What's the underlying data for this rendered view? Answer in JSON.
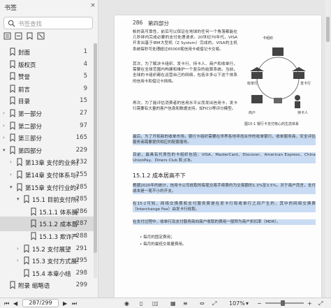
{
  "sidebar": {
    "title": "书签",
    "close_glyph": "×",
    "search_placeholder": "书签查找",
    "items": [
      {
        "label": "封面",
        "page": "1"
      },
      {
        "label": "版权页",
        "page": "4"
      },
      {
        "label": "赞誉",
        "page": "5"
      },
      {
        "label": "前言",
        "page": "9"
      },
      {
        "label": "目录",
        "page": "15"
      },
      {
        "label": "第一部分",
        "page": "27"
      },
      {
        "label": "第二部分",
        "page": "97"
      },
      {
        "label": "第三部分",
        "page": "165"
      },
      {
        "label": "第四部分",
        "page": "229"
      },
      {
        "label": "第13章 支付的业务监管",
        "page": "232"
      },
      {
        "label": "第14章 支付体系与清算",
        "page": "255"
      },
      {
        "label": "第15章 支付行业的未来",
        "page": "285"
      },
      {
        "label": "15.1 目前支付所面临的问题",
        "page": "285"
      },
      {
        "label": "15.1.1 体系臃肿",
        "page": "286"
      },
      {
        "label": "15.1.2 成本居高不下",
        "page": "287"
      },
      {
        "label": "15.1.3 欺诈严重",
        "page": "288"
      },
      {
        "label": "15.2 支付展望",
        "page": "291"
      },
      {
        "label": "15.3 支付方式展望",
        "page": "295"
      },
      {
        "label": "15.4 本章小结",
        "page": "298"
      },
      {
        "label": "附录 缩略语",
        "page": "299"
      }
    ]
  },
  "document": {
    "header_page": "286",
    "header_part": "第四部分",
    "section_title": "15.1.2 成本居高不下",
    "figure_caption": "图15-1 银行卡支付核心的生态体系",
    "figure_labels": {
      "top": "卡组织",
      "right": "发卡行",
      "bottom": "持卡人",
      "left": "收单行",
      "merchant": "商户"
    },
    "paragraphs": [
      "帐的高可靠性，前后可以保证在地球的任何一个角落都能在几秒钟内完成必要的支付处理请求。20世纪70年代，VISA开发出基于IBM大型机（Z System）完成的。VISA的主机系统每秒可处理超过65000笔信用卡或借记卡交易。",
      "其次，为了解决卡组织、发卡行、持卡人、商户和收单行，需要在全球范围内构建和维护一个复杂的结算系统。当前，全球的卡组织都在运营自己的网络，包括许多以下这个体系的信用卡和借记卡网络。",
      "再次，为了能评估消费者的信用水平从而发出信用卡，发卡行需要有大量的客户信息和数据支持，如FICO等评分模型。",
      "最后，为了开拓新的收单市场，银行卡组织需要在世界各地寻找合作的收单银行，收单服务商，安全评估服务商需要提供相应的配套服务。",
      "目前，最具有代表性的卡组织包括：VISA、MasterCard、Discover、American Express、China UnionPay、Diners Club 和 JCB。",
      "根据2020年的统计，信用卡公司收取的每笔交易手续费约为交易额的1.3%至3.5%，对于商户而言，支付成本是一笔不小的开支。",
      "在15-2可知，网络交换费和支付服务费是在发卡行和收单行之间产生的，其中的网络交换费（Interchange Fee）由发卡行收取。",
      "在支付过程中，收单行及支付服务商向商户收取的费用一般称为商户折扣率（MDR）。",
      "• 每月的固定费用；",
      "• 每月的最低交易量费用。"
    ]
  },
  "status_bar": {
    "page_display": "287/299",
    "zoom": "107%"
  },
  "icons": {
    "search": "search-icon",
    "bookmark": "bookmark-icon",
    "chevron": "chevron-icon"
  },
  "colors": {
    "highlight": "#c9dcf3",
    "selected_row": "#d9d9d9"
  }
}
